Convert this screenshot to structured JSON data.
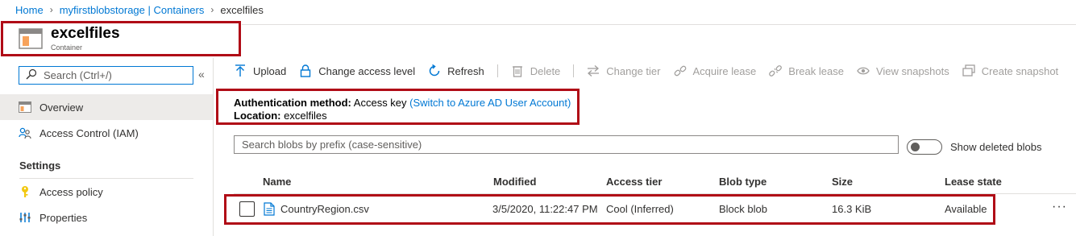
{
  "breadcrumb": {
    "items": [
      "Home",
      "myfirstblobstorage | Containers"
    ],
    "current": "excelfiles"
  },
  "header": {
    "title": "excelfiles",
    "subtitle": "Container"
  },
  "sidebar": {
    "search_placeholder": "Search (Ctrl+/)",
    "collapse_glyph": "«",
    "items": [
      {
        "label": "Overview",
        "icon": "overview-icon"
      },
      {
        "label": "Access Control (IAM)",
        "icon": "people-icon"
      }
    ],
    "section_label": "Settings",
    "settings_items": [
      {
        "label": "Access policy",
        "icon": "key-icon"
      },
      {
        "label": "Properties",
        "icon": "properties-icon"
      }
    ]
  },
  "toolbar": {
    "upload": "Upload",
    "change_access_level": "Change access level",
    "refresh": "Refresh",
    "delete": "Delete",
    "change_tier": "Change tier",
    "acquire_lease": "Acquire lease",
    "break_lease": "Break lease",
    "view_snapshots": "View snapshots",
    "create_snapshot": "Create snapshot"
  },
  "info": {
    "auth_label": "Authentication method:",
    "auth_value": "Access key",
    "auth_link": "(Switch to Azure AD User Account)",
    "location_label": "Location:",
    "location_value": "excelfiles"
  },
  "blob_search": {
    "placeholder": "Search blobs by prefix (case-sensitive)"
  },
  "toggle": {
    "label": "Show deleted blobs",
    "on": false
  },
  "table": {
    "columns": [
      "Name",
      "Modified",
      "Access tier",
      "Blob type",
      "Size",
      "Lease state"
    ],
    "rows": [
      {
        "name": "CountryRegion.csv",
        "modified": "3/5/2020, 11:22:47 PM",
        "access_tier": "Cool (Inferred)",
        "blob_type": "Block blob",
        "size": "16.3 KiB",
        "lease_state": "Available"
      }
    ],
    "more_glyph": "···"
  },
  "colors": {
    "accent": "#0078d4",
    "highlight_border": "#b00b16",
    "disabled_text": "#a19f9d"
  }
}
